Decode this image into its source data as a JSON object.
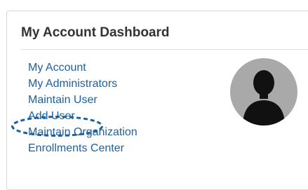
{
  "dashboard": {
    "title": "My Account Dashboard",
    "links": [
      {
        "label": "My Account"
      },
      {
        "label": "My Administrators"
      },
      {
        "label": "Maintain User"
      },
      {
        "label": "Add User"
      },
      {
        "label": "Maintain Organization"
      },
      {
        "label": "Enrollments Center"
      }
    ],
    "highlighted_link": "Add User",
    "avatar_icon": "user-silhouette-icon"
  },
  "colors": {
    "link": "#1f5f9e",
    "highlight_outline": "#1f5f9e",
    "title": "#333333",
    "avatar_bg": "#a9a9a9",
    "silhouette": "#111111"
  }
}
